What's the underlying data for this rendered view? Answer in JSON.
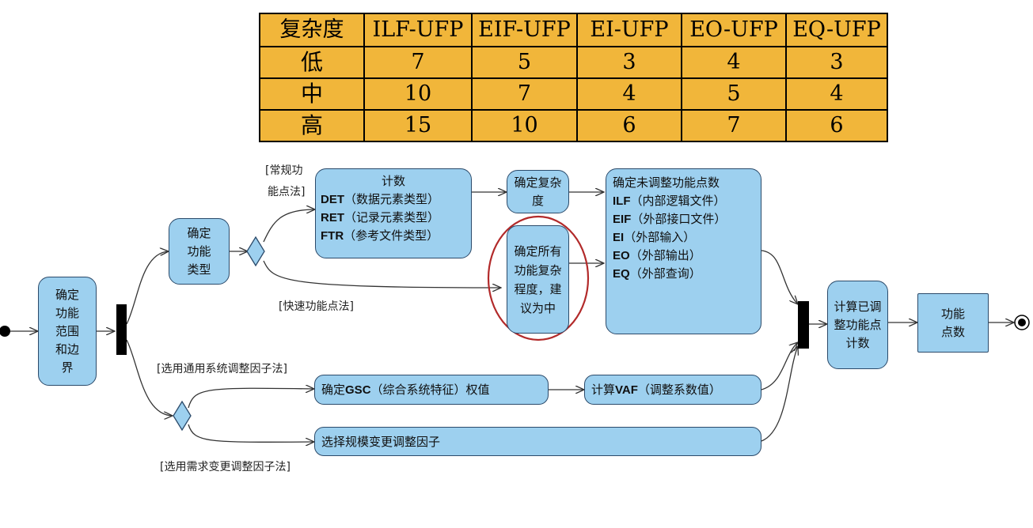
{
  "complexity_table": {
    "headers": [
      "复杂度",
      "ILF-UFP",
      "EIF-UFP",
      "EI-UFP",
      "EO-UFP",
      "EQ-UFP"
    ],
    "rows": [
      [
        "低",
        "7",
        "5",
        "3",
        "4",
        "3"
      ],
      [
        "中",
        "10",
        "7",
        "4",
        "5",
        "4"
      ],
      [
        "高",
        "15",
        "10",
        "6",
        "7",
        "6"
      ]
    ]
  },
  "nodes": {
    "scope": "确定功能范围和边界",
    "type": "确定功能类型",
    "count_title": "计数",
    "count_items": [
      {
        "abbr": "DET",
        "desc": "（数据元素类型）"
      },
      {
        "abbr": "RET",
        "desc": "（记录元素类型）"
      },
      {
        "abbr": "FTR",
        "desc": "（参考文件类型）"
      }
    ],
    "complexity": "确定复杂度",
    "all_medium": "确定所有功能复杂程度，建议为中",
    "ufp_title": "确定未调整功能点数",
    "ufp_items": [
      {
        "abbr": "ILF",
        "desc": "（内部逻辑文件）"
      },
      {
        "abbr": "EIF",
        "desc": "（外部接口文件）"
      },
      {
        "abbr": "EI",
        "desc": "（外部输入）"
      },
      {
        "abbr": "EO",
        "desc": "（外部输出）"
      },
      {
        "abbr": "EQ",
        "desc": "（外部查询）"
      }
    ],
    "gsc_pre": "确定",
    "gsc_abbr": "GSC",
    "gsc_post": "（综合系统特征）权值",
    "vaf_pre": "计算",
    "vaf_abbr": "VAF",
    "vaf_post": "（调整系数值）",
    "scale": "选择规模变更调整因子",
    "adjusted": "计算已调整功能点计数",
    "fp": "功能点数"
  },
  "labels": {
    "regular_1": "[常规功",
    "regular_2": "能点法]",
    "fast": "[快速功能点法]",
    "general": "[选用通用系统调整因子法]",
    "demand": "[选用需求变更调整因子法]"
  },
  "colors": {
    "node_fill": "#9dd0ef",
    "table_fill": "#f1b63a",
    "highlight_ring": "#b22a2a"
  }
}
